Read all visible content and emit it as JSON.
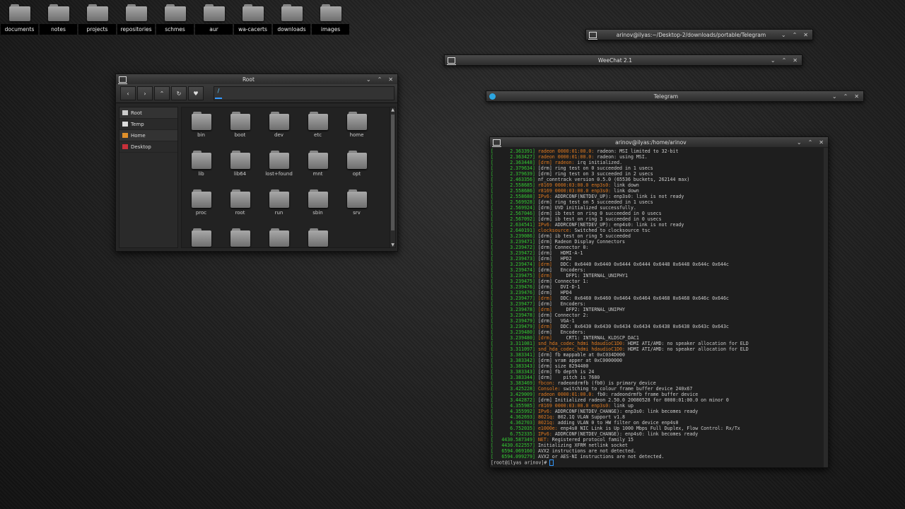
{
  "desktop_icons": [
    "documents",
    "notes",
    "projects",
    "repositories",
    "schmes",
    "aur",
    "wa-cacerts",
    "downloads",
    "images"
  ],
  "minimized_windows": [
    {
      "title": "arinov@ilyas:~/Desktop-2/downloads/portable/Telegram",
      "icon": "terminal-icon"
    },
    {
      "title": "WeeChat 2.1",
      "icon": "terminal-icon"
    },
    {
      "title": "Telegram",
      "icon": "telegram-icon"
    }
  ],
  "window_buttons": {
    "minimize": "⌄",
    "maximize": "⌃",
    "close": "✕"
  },
  "file_manager": {
    "title": "Root",
    "toolbar": {
      "back": "‹",
      "forward": "›",
      "up": "⌃",
      "reload": "↻",
      "bookmark": "♥"
    },
    "path": "/",
    "sidebar": [
      {
        "label": "Root",
        "icon": "drive-icon",
        "color": "#cccccc"
      },
      {
        "label": "Temp",
        "icon": "temp-icon",
        "color": "#dddddd"
      },
      {
        "label": "Home",
        "icon": "home-icon",
        "color": "#e0902a"
      },
      {
        "label": "Desktop",
        "icon": "desktop-icon",
        "color": "#c8303a"
      }
    ],
    "folders": [
      "bin",
      "boot",
      "dev",
      "etc",
      "home",
      "lib",
      "lib64",
      "lost+found",
      "mnt",
      "opt",
      "proc",
      "root",
      "run",
      "sbin",
      "srv",
      "",
      "",
      "",
      ""
    ]
  },
  "terminal": {
    "title": "arinov@ilyas:/home/arinov",
    "lines": [
      {
        "t": "2.363391",
        "m": "radeon 0000:01:00.0:",
        "s": " radeon: MSI limited to 32-bit"
      },
      {
        "t": "2.363427",
        "m": "radeon 0000:01:00.0:",
        "s": " radeon: using MSI."
      },
      {
        "t": "2.363448",
        "m": "[drm] radeon:",
        "s": " irq initialized."
      },
      {
        "t": "2.379634",
        "m": "",
        "s": "[drm] ring test on 0 succeeded in 1 usecs"
      },
      {
        "t": "2.379639",
        "m": "",
        "s": "[drm] ring test on 3 succeeded in 2 usecs"
      },
      {
        "t": "2.463356",
        "m": "",
        "s": "nf_conntrack version 0.5.0 (65536 buckets, 262144 max)"
      },
      {
        "t": "2.558685",
        "m": "r8169 0000:03:00.0 enp3s0:",
        "s": " link down"
      },
      {
        "t": "2.558686",
        "m": "r8169 0000:03:00.0 enp3s0:",
        "s": " link down"
      },
      {
        "t": "2.558688",
        "m": "IPv6:",
        "s": " ADDRCONF(NETDEV_UP): enp3s0: link is not ready"
      },
      {
        "t": "2.569928",
        "m": "",
        "s": "[drm] ring test on 5 succeeded in 1 usecs"
      },
      {
        "t": "2.569924",
        "m": "",
        "s": "[drm] UVD initialized successfully."
      },
      {
        "t": "2.567046",
        "m": "",
        "s": "[drm] ib test on ring 0 succeeded in 0 usecs"
      },
      {
        "t": "2.567092",
        "m": "",
        "s": "[drm] ib test on ring 3 succeeded in 0 usecs"
      },
      {
        "t": "2.634541",
        "m": "IPv6:",
        "s": " ADDRCONF(NETDEV_UP): enp4s0: link is not ready"
      },
      {
        "t": "2.640191",
        "m": "clocksource:",
        "s": " Switched to clocksource tsc"
      },
      {
        "t": "3.239086",
        "m": "",
        "s": "[drm] ib test on ring 5 succeeded"
      },
      {
        "t": "3.239471",
        "m": "",
        "s": "[drm] Radeon Display Connectors"
      },
      {
        "t": "3.239472",
        "m": "",
        "s": "[drm] Connector 0:"
      },
      {
        "t": "3.239472",
        "m": "",
        "s": "[drm]   HDMI-A-1"
      },
      {
        "t": "3.239473",
        "m": "",
        "s": "[drm]   HPD2"
      },
      {
        "t": "3.239474",
        "m": "[drm]",
        "s": "   DDC: 0x6440 0x6440 0x6444 0x6444 0x6448 0x6448 0x644c 0x644c"
      },
      {
        "t": "3.239474",
        "m": "",
        "s": "[drm]   Encoders:"
      },
      {
        "t": "3.239475",
        "m": "[drm]",
        "s": "     DFP1: INTERNAL_UNIPHY1"
      },
      {
        "t": "3.239475",
        "m": "",
        "s": "[drm] Connector 1:"
      },
      {
        "t": "3.239476",
        "m": "",
        "s": "[drm]   DVI-D-1"
      },
      {
        "t": "3.239476",
        "m": "",
        "s": "[drm]   HPD4"
      },
      {
        "t": "3.239477",
        "m": "[drm]",
        "s": "   DDC: 0x6460 0x6460 0x6464 0x6464 0x6468 0x6468 0x646c 0x646c"
      },
      {
        "t": "3.239477",
        "m": "",
        "s": "[drm]   Encoders:"
      },
      {
        "t": "3.239478",
        "m": "[drm]",
        "s": "     DFP2: INTERNAL_UNIPHY"
      },
      {
        "t": "3.239478",
        "m": "",
        "s": "[drm] Connector 2:"
      },
      {
        "t": "3.239479",
        "m": "",
        "s": "[drm]   VGA-1"
      },
      {
        "t": "3.239479",
        "m": "[drm]",
        "s": "   DDC: 0x6430 0x6430 0x6434 0x6434 0x6438 0x6438 0x643c 0x643c"
      },
      {
        "t": "3.239480",
        "m": "",
        "s": "[drm]   Encoders:"
      },
      {
        "t": "3.239480",
        "m": "[drm]",
        "s": "     CRT1: INTERNAL_KLDSCP_DAC1"
      },
      {
        "t": "3.311081",
        "m": "snd_hda_codec_hdmi hdaudioC1D0:",
        "s": " HDMI ATI/AMD: no speaker allocation for ELD"
      },
      {
        "t": "3.311097",
        "m": "snd_hda_codec_hdmi hdaudioC1D0:",
        "s": " HDMI ATI/AMD: no speaker allocation for ELD"
      },
      {
        "t": "3.383341",
        "m": "",
        "s": "[drm] fb mappable at 0xC034D000"
      },
      {
        "t": "3.383342",
        "m": "",
        "s": "[drm] vram apper at 0xC0000000"
      },
      {
        "t": "3.383343",
        "m": "",
        "s": "[drm] size 8294400"
      },
      {
        "t": "3.383343",
        "m": "",
        "s": "[drm] fb depth is 24"
      },
      {
        "t": "3.383344",
        "m": "",
        "s": "[drm]    pitch is 7680"
      },
      {
        "t": "3.383469",
        "m": "fbcon:",
        "s": " radeondrmfb (fb0) is primary device"
      },
      {
        "t": "3.425228",
        "m": "Console:",
        "s": " switching to colour frame buffer device 240x67"
      },
      {
        "t": "3.429009",
        "m": "radeon 0000:01:00.0:",
        "s": " fb0: radeondrmfb frame buffer device"
      },
      {
        "t": "3.442872",
        "m": "",
        "s": "[drm] Initialized radeon 2.50.0 20080528 for 0000:01:00.0 on minor 0"
      },
      {
        "t": "4.355985",
        "m": "r8169 0000:03:00.0 enp3s0:",
        "s": " link up"
      },
      {
        "t": "4.355992",
        "m": "IPv6:",
        "s": " ADDRCONF(NETDEV_CHANGE): enp3s0: link becomes ready"
      },
      {
        "t": "4.362693",
        "m": "8021q:",
        "s": " 802.1Q VLAN Support v1.8"
      },
      {
        "t": "4.362703",
        "m": "8021q:",
        "s": " adding VLAN 0 to HW filter on device enp4s0"
      },
      {
        "t": "6.752035",
        "m": "e1000e:",
        "s": " enp4s0 NIC Link is Up 1000 Mbps Full Duplex, Flow Control: Rx/Tx"
      },
      {
        "t": "6.752335",
        "m": "IPv6:",
        "s": " ADDRCONF(NETDEV_CHANGE): enp4s0: link becomes ready"
      },
      {
        "t": "4430.587349",
        "m": "NET:",
        "s": " Registered protocol family 15"
      },
      {
        "t": "4430.622557",
        "m": "",
        "s": "Initializing XFRM netlink socket"
      },
      {
        "t": "6594.069160",
        "m": "",
        "s": "AVX2 instructions are not detected."
      },
      {
        "t": "6594.099279",
        "m": "",
        "s": "AVX2 or AES-NI instructions are not detected."
      }
    ],
    "prompt": "[root@ilyas arinov]# "
  }
}
